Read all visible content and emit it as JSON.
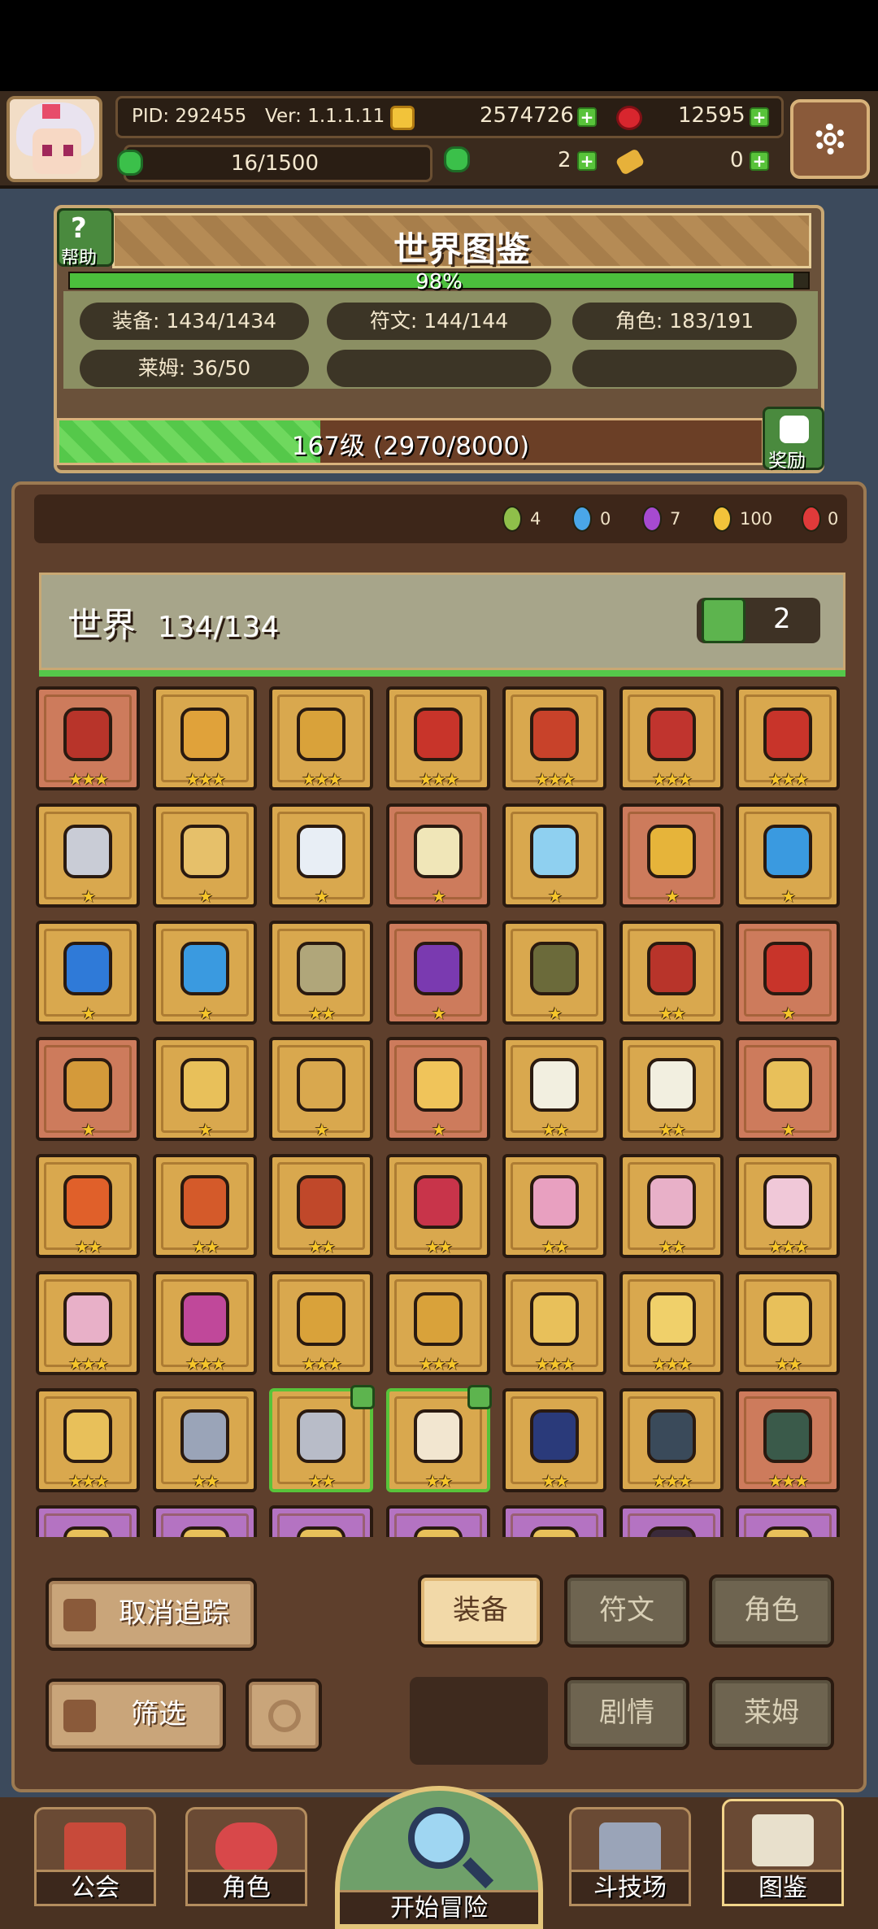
{
  "header": {
    "pid": "PID: 292455",
    "version": "Ver: 1.1.1.11",
    "gold": "2574726",
    "rubies": "12595",
    "stamina": "16/1500",
    "clover": "2",
    "keys": "0"
  },
  "encyclopedia": {
    "title": "世界图鉴",
    "help_label": "帮助",
    "progress_percent": "98%",
    "progress_value": 0.98,
    "stats": [
      "装备: 1434/1434",
      "符文: 144/144",
      "角色: 183/191",
      "莱姆: 36/50"
    ],
    "level_text": "167级 (2970/8000)",
    "level_progress": 0.371,
    "reward_label": "奖励"
  },
  "gems": [
    {
      "color": "#8fbf4a",
      "count": "4"
    },
    {
      "color": "#4aa6e8",
      "count": "0"
    },
    {
      "color": "#a64ad0",
      "count": "7"
    },
    {
      "color": "#f2c33a",
      "count": "100"
    },
    {
      "color": "#e03a3a",
      "count": "0"
    }
  ],
  "world": {
    "label": "世界",
    "count": "134/134",
    "likes": "2"
  },
  "grid": {
    "rows": [
      [
        {
          "bg": "red",
          "c": "#b8342a",
          "s": 3
        },
        {
          "bg": "gold",
          "c": "#e0a23a",
          "s": 3
        },
        {
          "bg": "gold",
          "c": "#d9a23a",
          "s": 3
        },
        {
          "bg": "gold",
          "c": "#c8342a",
          "s": 3
        },
        {
          "bg": "gold",
          "c": "#c8422a",
          "s": 3
        },
        {
          "bg": "gold",
          "c": "#c0342e",
          "s": 3
        },
        {
          "bg": "gold",
          "c": "#c8342a",
          "s": 3
        }
      ],
      [
        {
          "bg": "gold",
          "c": "#c9ccd6",
          "s": 1
        },
        {
          "bg": "gold",
          "c": "#e6c06a",
          "s": 1
        },
        {
          "bg": "gold",
          "c": "#e8eef5",
          "s": 1
        },
        {
          "bg": "red",
          "c": "#f0e6b8",
          "s": 1
        },
        {
          "bg": "gold",
          "c": "#8fd0f0",
          "s": 1
        },
        {
          "bg": "red",
          "c": "#e6b43a",
          "s": 1
        },
        {
          "bg": "gold",
          "c": "#3a9ae0",
          "s": 1
        }
      ],
      [
        {
          "bg": "gold",
          "c": "#2f7ad8",
          "s": 1
        },
        {
          "bg": "gold",
          "c": "#3a9ae0",
          "s": 1
        },
        {
          "bg": "gold",
          "c": "#b0a67a",
          "s": 2
        },
        {
          "bg": "red",
          "c": "#7a3ab0",
          "s": 1
        },
        {
          "bg": "gold",
          "c": "#6b6a3a",
          "s": 1
        },
        {
          "bg": "gold",
          "c": "#b8342a",
          "s": 2
        },
        {
          "bg": "red",
          "c": "#c8342a",
          "s": 1
        }
      ],
      [
        {
          "bg": "red",
          "c": "#d49a3a",
          "s": 1
        },
        {
          "bg": "gold",
          "c": "#e8c05a",
          "s": 1
        },
        {
          "bg": "gold",
          "c": "#d9a84e",
          "s": 1
        },
        {
          "bg": "red",
          "c": "#f0c45a",
          "s": 1
        },
        {
          "bg": "gold",
          "c": "#f2efe0",
          "s": 2
        },
        {
          "bg": "gold",
          "c": "#f2efe0",
          "s": 2
        },
        {
          "bg": "red",
          "c": "#e8c05a",
          "s": 1
        }
      ],
      [
        {
          "bg": "gold",
          "c": "#e0602a",
          "s": 2
        },
        {
          "bg": "gold",
          "c": "#d45a2a",
          "s": 2
        },
        {
          "bg": "gold",
          "c": "#c0482a",
          "s": 2
        },
        {
          "bg": "gold",
          "c": "#c8344a",
          "s": 2
        },
        {
          "bg": "gold",
          "c": "#e8a0c0",
          "s": 2
        },
        {
          "bg": "gold",
          "c": "#e8b0c8",
          "s": 2
        },
        {
          "bg": "gold",
          "c": "#f0c8d8",
          "s": 3
        }
      ],
      [
        {
          "bg": "gold",
          "c": "#e8b0c8",
          "s": 3
        },
        {
          "bg": "gold",
          "c": "#c0489a",
          "s": 3
        },
        {
          "bg": "gold",
          "c": "#d9a23a",
          "s": 3
        },
        {
          "bg": "gold",
          "c": "#d9a23a",
          "s": 3
        },
        {
          "bg": "gold",
          "c": "#e8c05a",
          "s": 3
        },
        {
          "bg": "gold",
          "c": "#f0d06a",
          "s": 3
        },
        {
          "bg": "gold",
          "c": "#e8c05a",
          "s": 2
        }
      ],
      [
        {
          "bg": "gold",
          "c": "#e8c05a",
          "s": 3
        },
        {
          "bg": "gold",
          "c": "#9aa4b8",
          "s": 2
        },
        {
          "bg": "sel",
          "c": "#b8bcc8",
          "s": 2
        },
        {
          "bg": "sel",
          "c": "#f2e6d0",
          "s": 2
        },
        {
          "bg": "gold",
          "c": "#2a3a7a",
          "s": 2
        },
        {
          "bg": "gold",
          "c": "#3a4a5a",
          "s": 3
        },
        {
          "bg": "red",
          "c": "#3a5a4a",
          "s": 3
        }
      ],
      [
        {
          "bg": "purple",
          "c": "#e8c05a",
          "s": 0
        },
        {
          "bg": "purple",
          "c": "#e8c05a",
          "s": 0
        },
        {
          "bg": "purple",
          "c": "#e8c05a",
          "s": 0
        },
        {
          "bg": "purple",
          "c": "#e8c05a",
          "s": 0
        },
        {
          "bg": "purple",
          "c": "#e8c05a",
          "s": 0
        },
        {
          "bg": "purple",
          "c": "#3a2a3a",
          "s": 0
        },
        {
          "bg": "purple",
          "c": "#e8c05a",
          "s": 0
        }
      ]
    ]
  },
  "buttons": {
    "untrack": "取消追踪",
    "filter": "筛选",
    "equipment": "装备",
    "runes": "符文",
    "characters": "角色",
    "story": "剧情",
    "slime": "莱姆"
  },
  "nav": {
    "guild": "公会",
    "character": "角色",
    "adventure": "开始冒险",
    "arena": "斗技场",
    "codex": "图鉴"
  }
}
